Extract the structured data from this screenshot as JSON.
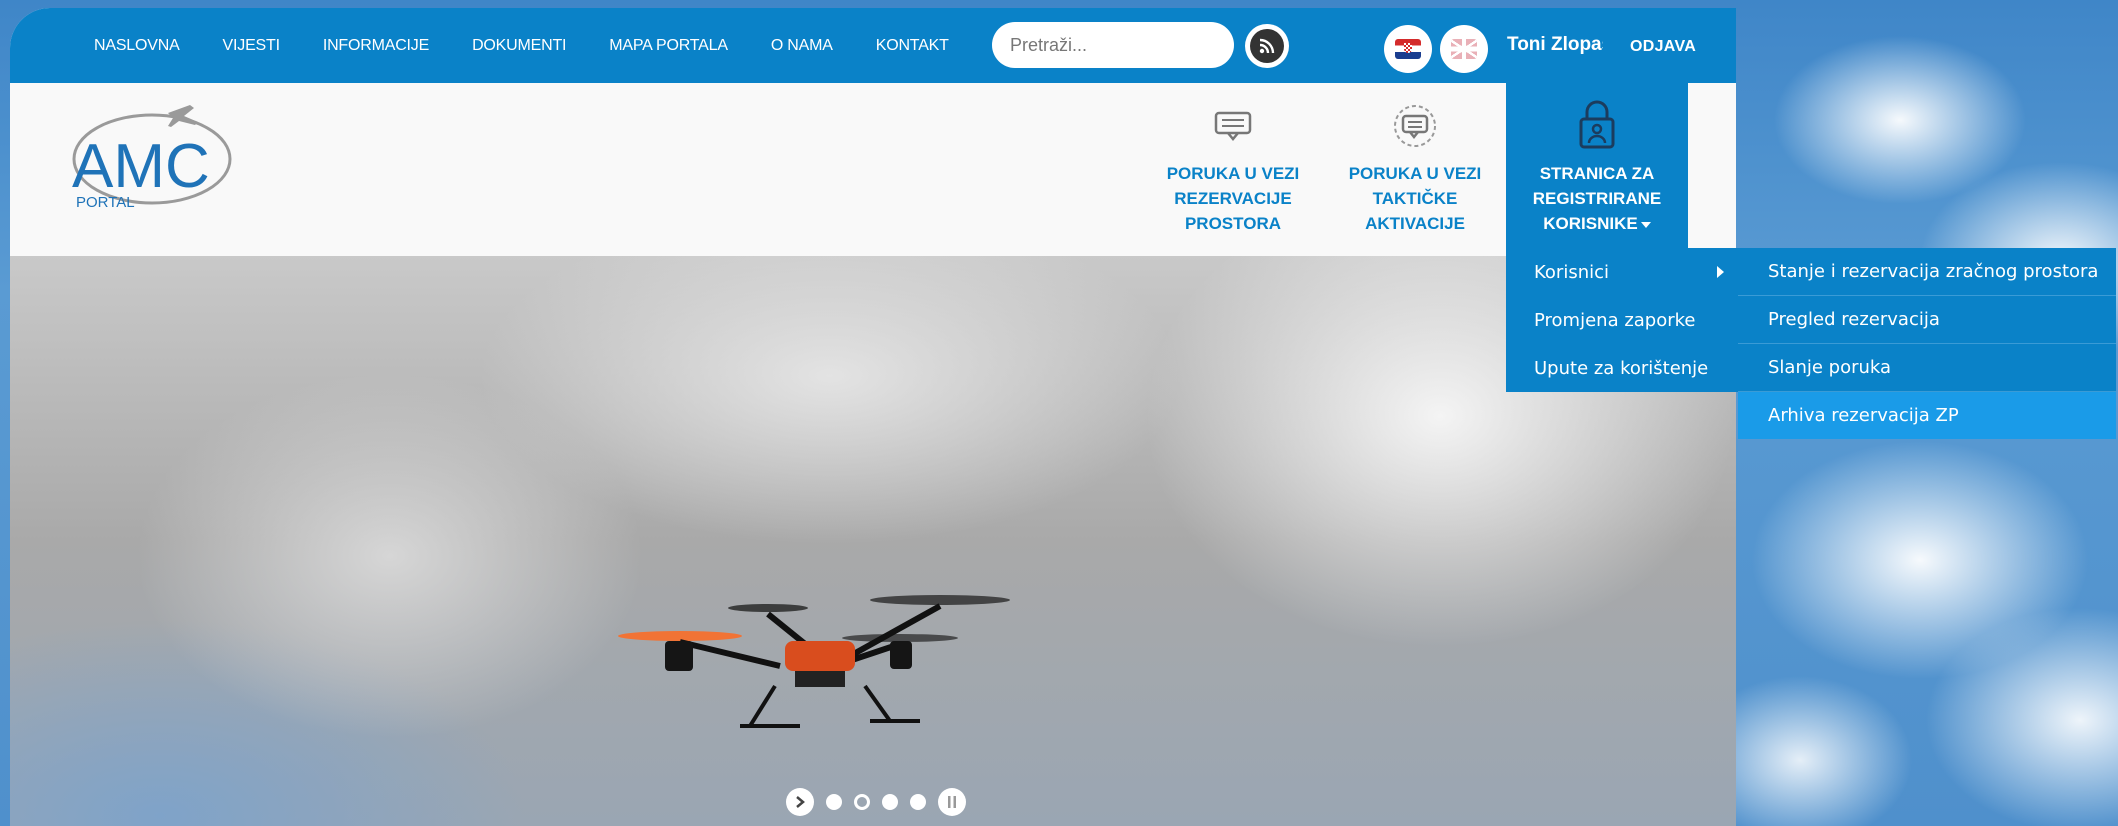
{
  "colors": {
    "brand_blue": "#0a82c8",
    "highlight_blue": "#1a9be8"
  },
  "nav": {
    "items": [
      "NASLOVNA",
      "VIJESTI",
      "INFORMACIJE",
      "DOKUMENTI",
      "MAPA PORTALA",
      "O NAMA",
      "KONTAKT"
    ]
  },
  "search": {
    "placeholder": "Pretraži...",
    "icon": "rss-icon"
  },
  "languages": [
    {
      "icon": "flag-croatia-icon"
    },
    {
      "icon": "flag-uk-icon"
    }
  ],
  "user": {
    "name": "Toni Zlopaša",
    "logout_label": "ODJAVA"
  },
  "logo": {
    "main": "AMC",
    "sub": "PORTAL"
  },
  "features": [
    {
      "icon": "message-icon",
      "line1": "PORUKA U VEZI",
      "line2": "REZERVACIJE",
      "line3": "PROSTORA"
    },
    {
      "icon": "chat-icon",
      "line1": "PORUKA U VEZI",
      "line2": "TAKTIČKE",
      "line3": "AKTIVACIJE"
    }
  ],
  "registered": {
    "icon": "lock-user-icon",
    "line1": "STRANICA ZA",
    "line2": "REGISTRIRANE",
    "line3": "KORISNIKE"
  },
  "dropdown": {
    "items": [
      "Korisnici",
      "Promjena zaporke",
      "Upute za korištenje"
    ]
  },
  "submenu": {
    "items": [
      "Stanje i rezervacija zračnog prostora",
      "Pregled rezervacija",
      "Slanje poruka",
      "Arhiva rezervacija ZP"
    ]
  },
  "slider": {
    "slides": 5,
    "active_slide": 2
  }
}
